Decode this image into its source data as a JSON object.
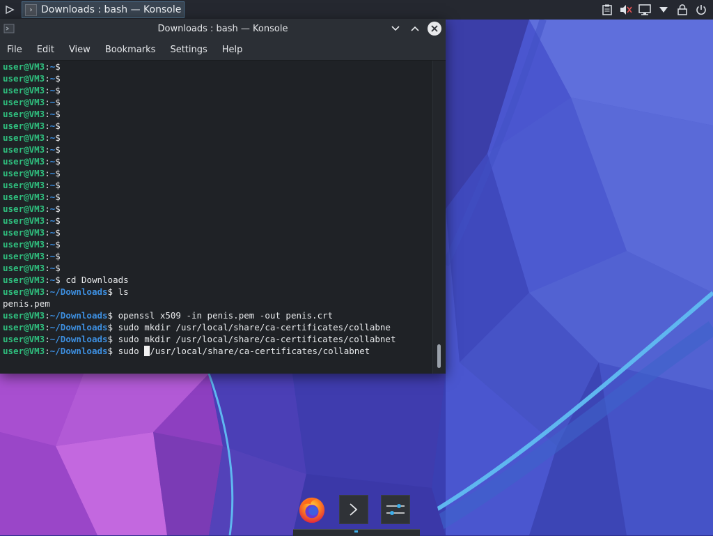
{
  "taskbar": {
    "active_task": "Downloads : bash — Konsole"
  },
  "window": {
    "title": "Downloads : bash — Konsole",
    "menu": [
      "File",
      "Edit",
      "View",
      "Bookmarks",
      "Settings",
      "Help"
    ]
  },
  "terminal": {
    "user_host": "user@VM3",
    "home": "~",
    "downloads": "~/Downloads",
    "empty_prompt_count": 18,
    "lines": [
      {
        "cwd": "~",
        "cmd": "cd Downloads"
      },
      {
        "cwd": "~/Downloads",
        "cmd": "ls"
      },
      {
        "output": "penis.pem"
      },
      {
        "cwd": "~/Downloads",
        "cmd": "openssl x509 -in penis.pem -out penis.crt"
      },
      {
        "cwd": "~/Downloads",
        "cmd": "sudo mkdir /usr/local/share/ca-certificates/collabne"
      },
      {
        "cwd": "~/Downloads",
        "cmd": "sudo mkdir /usr/local/share/ca-certificates/collabnet"
      },
      {
        "cwd": "~/Downloads",
        "cmd_before_cursor": "sudo ",
        "cmd_after_cursor": "/usr/local/share/ca-certificates/collabnet",
        "cursor": true
      }
    ]
  },
  "tray_icons": [
    "clipboard-icon",
    "volume-muted-icon",
    "network-icon",
    "expand-arrow-icon",
    "lock-icon",
    "power-icon"
  ],
  "dock": [
    "firefox-icon",
    "konsole-icon",
    "settings-icon"
  ]
}
